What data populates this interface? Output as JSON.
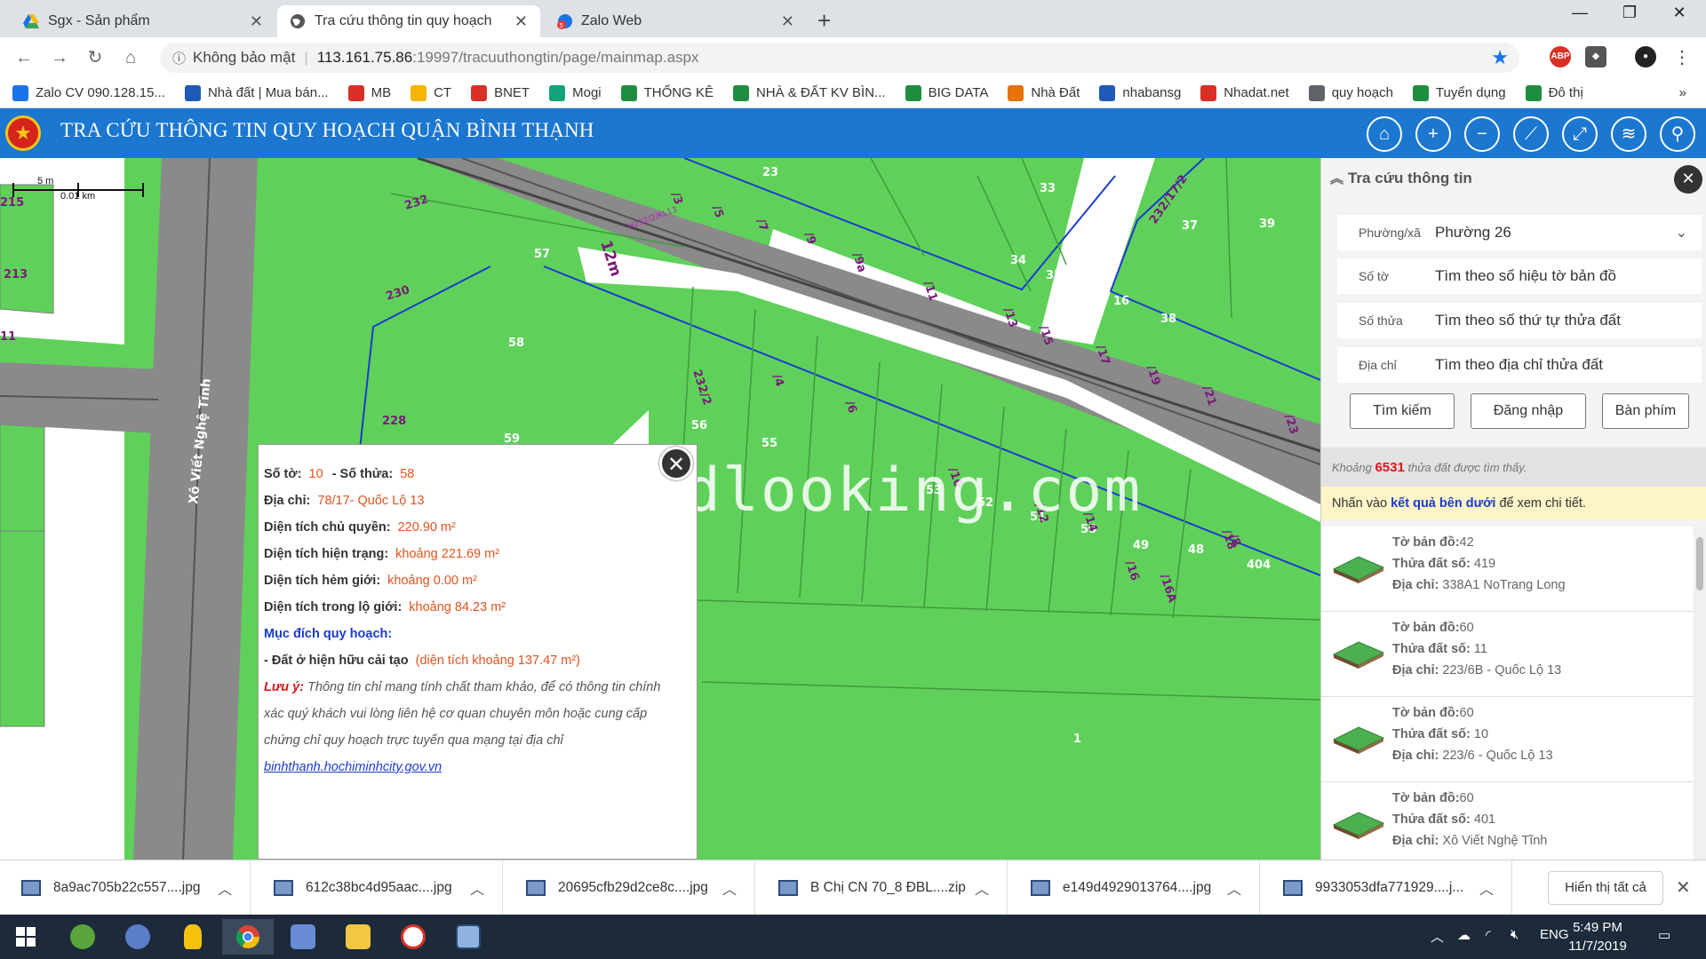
{
  "browser": {
    "tabs": [
      {
        "label": "Sgx - Sản phẩm",
        "icon": "drive-icon"
      },
      {
        "label": "Tra cứu thông tin quy hoạch",
        "icon": "globe-icon"
      },
      {
        "label": "Zalo Web",
        "icon": "zalo-icon"
      }
    ],
    "new_tab": "+",
    "omnibox": {
      "security": "Không bảo mật",
      "host": "113.161.75.86",
      "path": ":19997/tracuuthongtin/page/mainmap.aspx"
    },
    "extensions": [
      "ABP"
    ],
    "bookmarks": [
      {
        "label": "Zalo CV 090.128.15...",
        "color": "#1a73e8"
      },
      {
        "label": "Nhà đất | Mua bán...",
        "color": "#1e5bb8"
      },
      {
        "label": "MB",
        "color": "#d93025"
      },
      {
        "label": "CT",
        "color": "#f4b400"
      },
      {
        "label": "BNET",
        "color": "#d93025"
      },
      {
        "label": "Mogi",
        "color": "#12a37a"
      },
      {
        "label": "THỐNG KÊ",
        "color": "#1e8e3e"
      },
      {
        "label": "NHÀ & ĐẤT KV BÌN...",
        "color": "#1e8e3e"
      },
      {
        "label": "BIG DATA",
        "color": "#1e8e3e"
      },
      {
        "label": "Nhà Đất",
        "color": "#e8710a"
      },
      {
        "label": "nhabansg",
        "color": "#1e5bb8"
      },
      {
        "label": "Nhadat.net",
        "color": "#d93025"
      },
      {
        "label": "quy hoạch",
        "color": "#5f6368"
      },
      {
        "label": "Tuyển dụng",
        "color": "#1e8e3e"
      },
      {
        "label": "Đô thị",
        "color": "#1e8e3e"
      }
    ],
    "bookmarks_more": "»"
  },
  "app": {
    "title": "TRA CỨU THÔNG TIN QUY HOẠCH QUẬN BÌNH THẠNH",
    "header_buttons": [
      "home-icon",
      "zoom-in-icon",
      "zoom-out-icon",
      "measure-icon",
      "fullscreen-icon",
      "layers-icon",
      "search-icon"
    ]
  },
  "map": {
    "scale": {
      "top": "5 m",
      "bottom": "0.01 km"
    },
    "street_label": "Xô Viết Nghệ Tĩnh",
    "road_width_label": "12m",
    "road_code_label": "H232/2/KL13",
    "parcel_labels": [
      "215",
      "213",
      "11",
      "232",
      "230",
      "228",
      "57",
      "58",
      "59",
      "56",
      "55",
      "232/2",
      "23",
      "33",
      "34",
      "35",
      "37",
      "39",
      "38",
      "16",
      "232/17/2",
      "404",
      "49",
      "48",
      "50",
      "53",
      "52",
      "51",
      "1",
      "/3",
      "/5",
      "/7",
      "/9",
      "/9a",
      "/11",
      "/13",
      "/15",
      "/17",
      "/19",
      "/21",
      "/23",
      "/4",
      "/6",
      "/8",
      "/10",
      "/12",
      "/14",
      "/16",
      "/16A",
      "/18"
    ],
    "watermark": "dlooking.com"
  },
  "popup": {
    "so_to_label": "Số tờ:",
    "so_to": "10",
    "so_thua_label": "- Số thửa:",
    "so_thua": "58",
    "dia_chi_label": "Địa chỉ:",
    "dia_chi": "78/17- Quốc Lộ 13",
    "dt_chu_quyen_label": "Diện tích chủ quyền:",
    "dt_chu_quyen": "220.90 m²",
    "dt_hien_trang_label": "Diện tích hiện trạng:",
    "dt_hien_trang": "khoảng 221.69 m²",
    "dt_hem_gioi_label": "Diện tích hẻm giới:",
    "dt_hem_gioi": "khoảng 0.00 m²",
    "dt_lo_gioi_label": "Diện tích trong lộ giới:",
    "dt_lo_gioi": "khoảng 84.23 m²",
    "muc_dich_label": "Mục đích quy hoạch:",
    "muc_dich_item": "- Đất ở hiện hữu cải tạo",
    "muc_dich_area": "(diện tích khoảng 137.47 m²)",
    "luu_y_label": "Lưu ý:",
    "luu_y_text": "Thông tin chỉ mang tính chất tham khảo, để có thông tin chính xác quý khách vui lòng liên hệ cơ quan chuyên môn hoặc cung cấp chứng chỉ quy hoạch trực tuyến qua mạng tại địa chỉ",
    "link": "binhthanh.hochiminhcity.gov.vn"
  },
  "panel": {
    "title": "Tra cứu thông tin",
    "fields": [
      {
        "label": "Phường/xã",
        "value": "Phường 26",
        "dropdown": true
      },
      {
        "label": "Số tờ",
        "value": "Tìm theo số hiệu tờ bản đồ"
      },
      {
        "label": "Số thửa",
        "value": "Tìm theo số thứ tự thửa đất"
      },
      {
        "label": "Địa chỉ",
        "value": "Tìm theo địa chỉ thửa đất"
      }
    ],
    "buttons": [
      "Tìm kiếm",
      "Đăng nhập",
      "Bàn phím"
    ],
    "found_prefix": "Khoảng",
    "found_count": "6531",
    "found_suffix": "thửa đất được tìm thấy.",
    "hint_prefix": "Nhấn vào",
    "hint_link": "kết quả bên dưới",
    "hint_suffix": "để xem chi tiết.",
    "result_labels": {
      "to": "Tờ bản đồ:",
      "thua": "Thửa đất số:",
      "diachi": "Địa chỉ:"
    },
    "results": [
      {
        "to": "42",
        "thua": "419",
        "diachi": "338A1 NoTrang Long"
      },
      {
        "to": "60",
        "thua": "11",
        "diachi": "223/6B - Quốc Lộ 13"
      },
      {
        "to": "60",
        "thua": "10",
        "diachi": "223/6 - Quốc Lộ 13"
      },
      {
        "to": "60",
        "thua": "401",
        "diachi": "Xô Viết Nghệ Tĩnh"
      }
    ]
  },
  "downloads": {
    "items": [
      "8a9ac705b22c557....jpg",
      "612c38bc4d95aac....jpg",
      "20695cfb29d2ce8c....jpg",
      "B Chị CN 70_8 ĐBL....zip",
      "e149d4929013764....jpg",
      "9933053dfa771929....j..."
    ],
    "show_all": "Hiển thị tất cả"
  },
  "taskbar": {
    "lang": "ENG",
    "time": "5:49 PM",
    "date": "11/7/2019"
  }
}
